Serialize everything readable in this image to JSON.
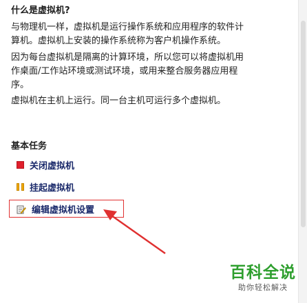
{
  "help": {
    "heading": "什么是虚拟机?",
    "paragraph1": "与物理机一样，虚拟机是运行操作系统和应用程序的软件计算机。虚拟机上安装的操作系统称为客户机操作系统。",
    "paragraph2": "因为每台虚拟机是隔离的计算环境，所以您可以将虚拟机用作桌面/工作站环境或测试环境，或用来整合服务器应用程序。",
    "paragraph3": "虚拟机在主机上运行。同一台主机可运行多个虚拟机。"
  },
  "tasks": {
    "title": "基本任务",
    "items": [
      {
        "label": "关闭虚拟机",
        "icon": "stop-icon"
      },
      {
        "label": "挂起虚拟机",
        "icon": "pause-icon"
      },
      {
        "label": "编辑虚拟机设置",
        "icon": "edit-settings-icon"
      }
    ]
  },
  "watermark": {
    "main": "百科全说",
    "sub": "助你轻松解决"
  },
  "colors": {
    "link": "#1b2a6b",
    "highlight": "#e03030",
    "watermark": "#2e9f2e"
  }
}
